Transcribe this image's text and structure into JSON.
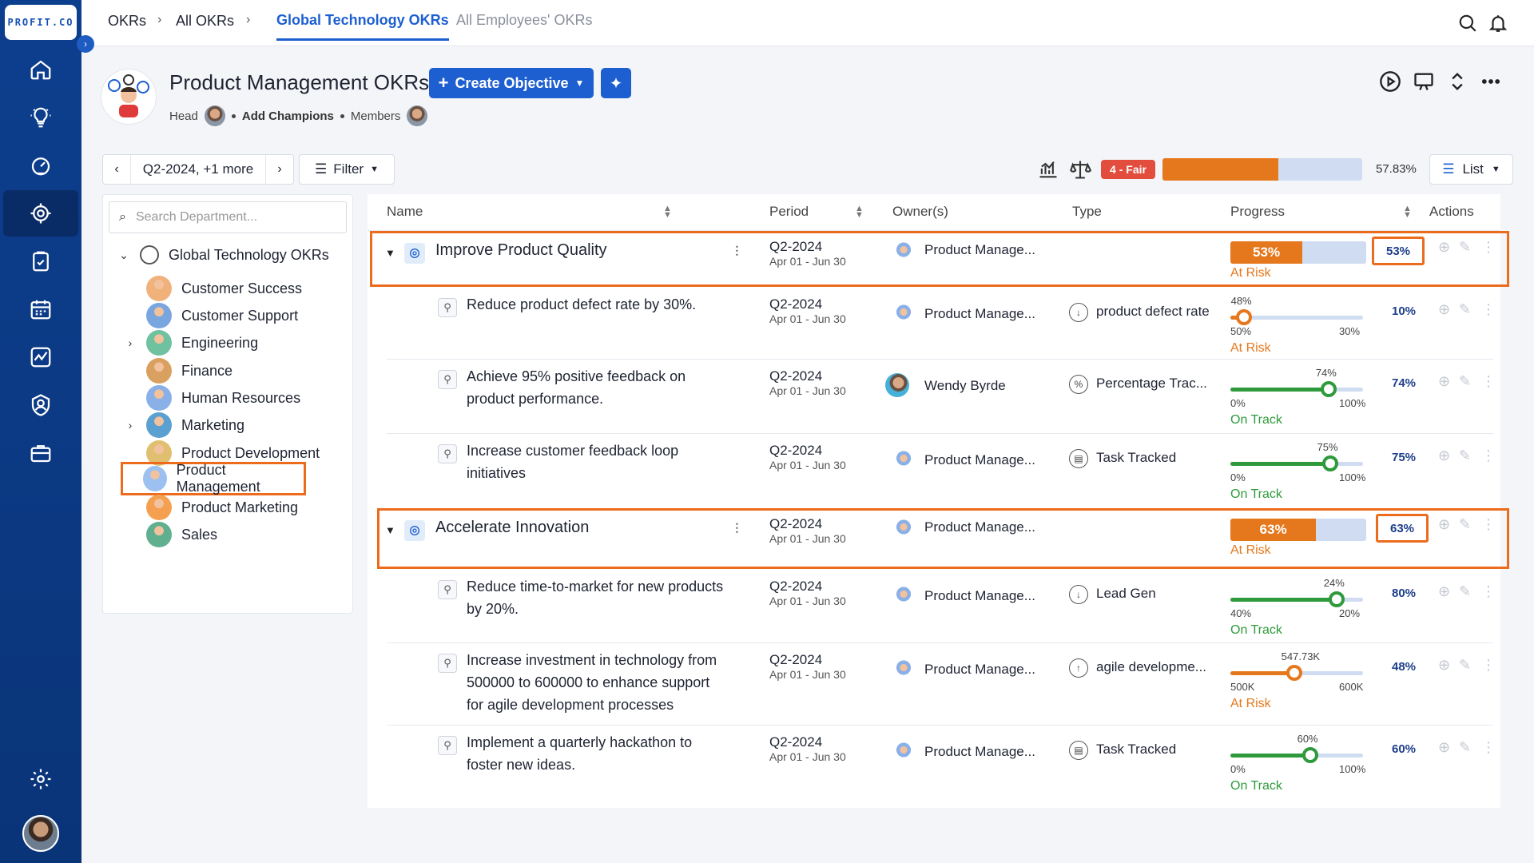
{
  "app": {
    "logo_text": "PROFIT.CO"
  },
  "breadcrumb": {
    "item1": "OKRs",
    "item2": "All OKRs"
  },
  "tabs": {
    "active": "Global Technology OKRs",
    "inactive": "All Employees' OKRs"
  },
  "header": {
    "title": "Product Management OKRs",
    "create_label": "Create Objective",
    "head_label": "Head",
    "add_champions": "Add Champions",
    "members_label": "Members"
  },
  "controls": {
    "period": "Q2-2024, +1 more",
    "filter": "Filter",
    "health_badge": "4 - Fair",
    "overall_progress_pct": "57.83%",
    "overall_progress_value": 57.83,
    "view": "List"
  },
  "departments": {
    "search_placeholder": "Search Department...",
    "root": "Global Technology OKRs",
    "items": [
      {
        "label": "Customer Success"
      },
      {
        "label": "Customer Support"
      },
      {
        "label": "Engineering"
      },
      {
        "label": "Finance"
      },
      {
        "label": "Human Resources"
      },
      {
        "label": "Marketing"
      },
      {
        "label": "Product Development"
      },
      {
        "label": "Product Management"
      },
      {
        "label": "Product Marketing"
      },
      {
        "label": "Sales"
      }
    ]
  },
  "columns": {
    "name": "Name",
    "period": "Period",
    "owners": "Owner(s)",
    "type": "Type",
    "progress": "Progress",
    "actions": "Actions"
  },
  "rows": [
    {
      "title": "Improve Product Quality",
      "period": "Q2-2024",
      "dates": "Apr 01 - Jun 30",
      "owner": "Product Manage...",
      "progress_label": "53%",
      "progress_value": 53,
      "status": "At Risk",
      "pct": "53%"
    },
    {
      "title": "Reduce product defect rate by 30%.",
      "period": "Q2-2024",
      "dates": "Apr 01 - Jun 30",
      "owner": "Product Manage...",
      "type": "product defect rate",
      "tip": "48%",
      "start": "50%",
      "end": "30%",
      "progress_value": 10,
      "status": "At Risk",
      "pct": "10%"
    },
    {
      "title": "Achieve 95% positive feedback on product performance.",
      "period": "Q2-2024",
      "dates": "Apr 01 - Jun 30",
      "owner": "Wendy Byrde",
      "type": "Percentage Trac...",
      "tip": "74%",
      "start": "0%",
      "end": "100%",
      "progress_value": 74,
      "status": "On Track",
      "pct": "74%"
    },
    {
      "title": "Increase customer feedback loop initiatives",
      "period": "Q2-2024",
      "dates": "Apr 01 - Jun 30",
      "owner": "Product Manage...",
      "type": "Task Tracked",
      "tip": "75%",
      "start": "0%",
      "end": "100%",
      "progress_value": 75,
      "status": "On Track",
      "pct": "75%"
    },
    {
      "title": "Accelerate Innovation",
      "period": "Q2-2024",
      "dates": "Apr 01 - Jun 30",
      "owner": "Product Manage...",
      "progress_label": "63%",
      "progress_value": 63,
      "status": "At Risk",
      "pct": "63%"
    },
    {
      "title": "Reduce time-to-market for new products by 20%.",
      "period": "Q2-2024",
      "dates": "Apr 01 - Jun 30",
      "owner": "Product Manage...",
      "type": "Lead Gen",
      "tip": "24%",
      "start": "40%",
      "end": "20%",
      "progress_value": 80,
      "status": "On Track",
      "pct": "80%"
    },
    {
      "title": "Increase investment in technology from 500000 to 600000 to enhance support for agile development processes",
      "period": "Q2-2024",
      "dates": "Apr 01 - Jun 30",
      "owner": "Product Manage...",
      "type": "agile developme...",
      "tip": "547.73K",
      "start": "500K",
      "end": "600K",
      "progress_value": 48,
      "status": "At Risk",
      "pct": "48%"
    },
    {
      "title": "Implement a quarterly hackathon to foster new ideas.",
      "period": "Q2-2024",
      "dates": "Apr 01 - Jun 30",
      "owner": "Product Manage...",
      "type": "Task Tracked",
      "tip": "60%",
      "start": "0%",
      "end": "100%",
      "progress_value": 60,
      "status": "On Track",
      "pct": "60%"
    }
  ],
  "colors": {
    "brand": "#1d5fd0",
    "risk": "#e5781d",
    "track": "#2e9a3b",
    "highlight": "#ec6b1c"
  }
}
